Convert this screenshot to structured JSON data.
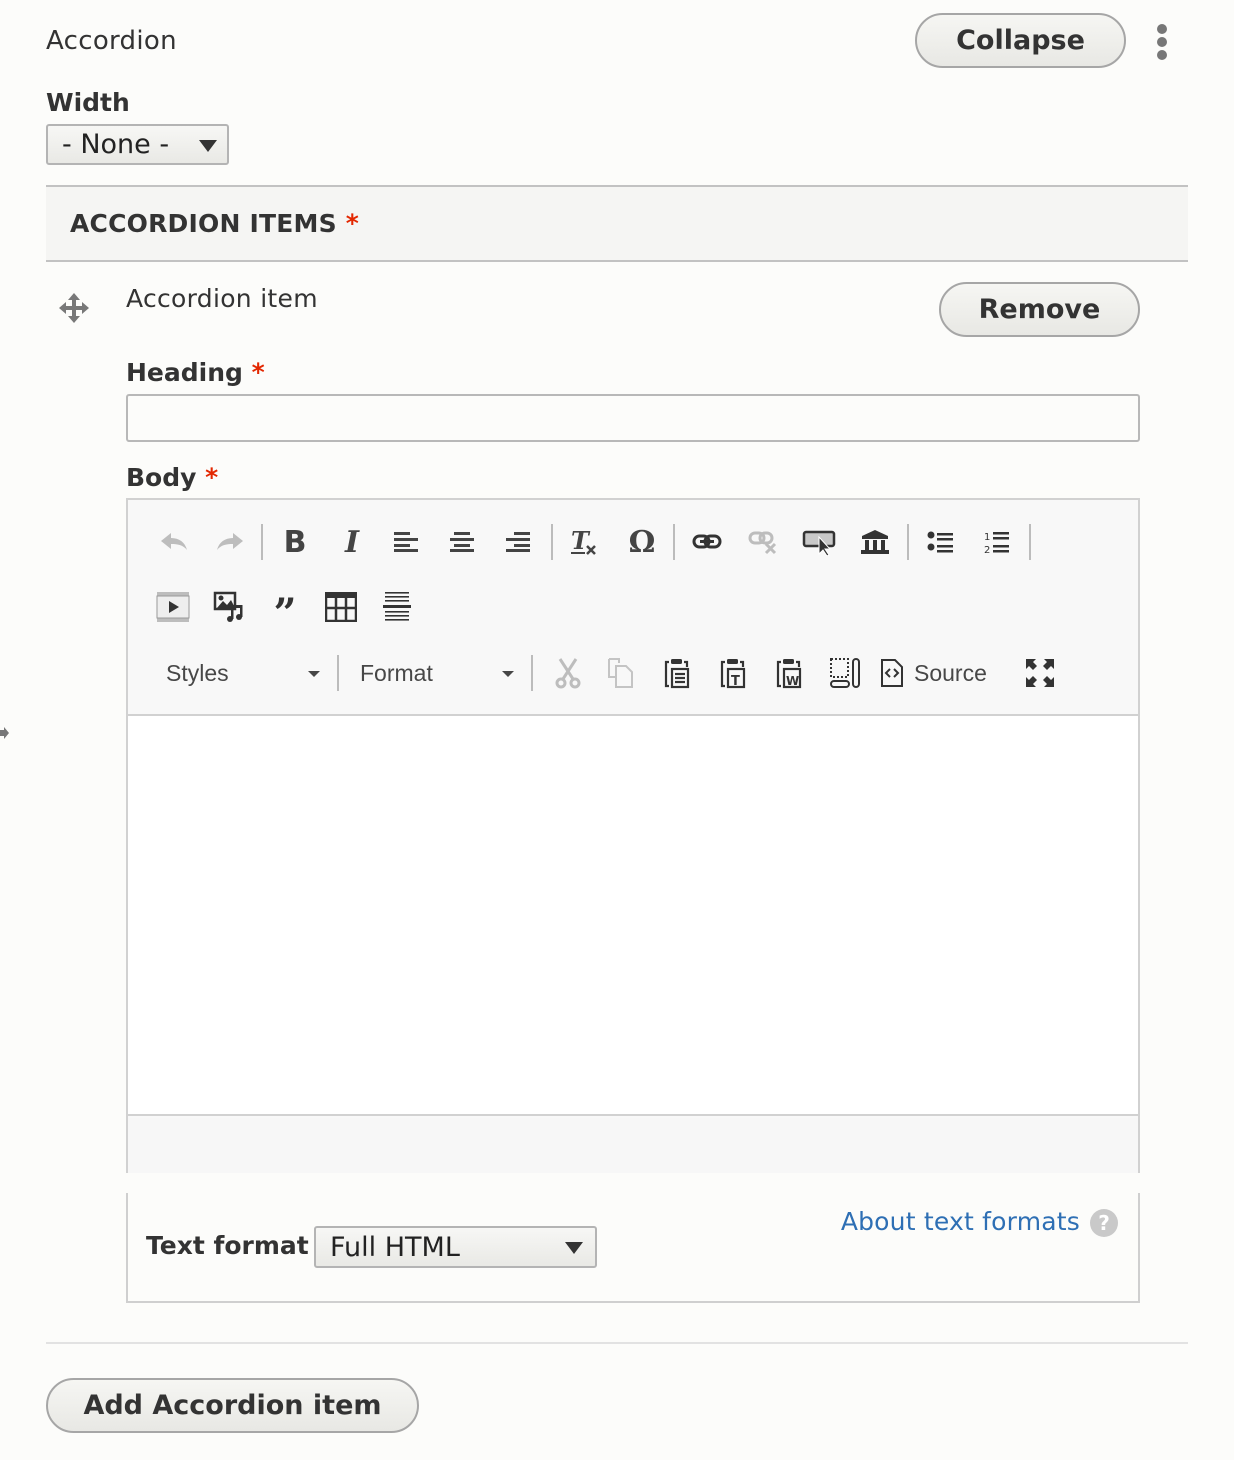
{
  "paragraph": {
    "title": "Accordion",
    "collapse_label": "Collapse",
    "menu_icon": "kebab-icon"
  },
  "width_field": {
    "label": "Width",
    "selected": "- None -"
  },
  "items_section": {
    "label": "ACCORDION ITEMS",
    "required_marker": "*"
  },
  "accordion_item": {
    "title": "Accordion item",
    "remove_label": "Remove",
    "drag_icon": "move-handle-icon",
    "heading": {
      "label": "Heading",
      "required_marker": "*",
      "value": "",
      "placeholder": ""
    },
    "body": {
      "label": "Body",
      "required_marker": "*",
      "value": ""
    }
  },
  "editor_toolbar": {
    "row1": [
      "undo-icon",
      "redo-icon",
      "bold-icon",
      "italic-icon",
      "align-left-icon",
      "align-center-icon",
      "align-right-icon",
      "remove-format-icon",
      "special-character-icon",
      "link-icon",
      "unlink-icon",
      "button-link-icon",
      "museum-icon",
      "bulleted-list-icon",
      "numbered-list-icon"
    ],
    "row2": [
      "video-icon",
      "media-icon",
      "blockquote-icon",
      "table-icon",
      "horizontal-line-icon"
    ],
    "styles_label": "Styles",
    "format_label": "Format",
    "row3": [
      "cut-icon",
      "copy-icon",
      "paste-icon",
      "paste-text-icon",
      "paste-word-icon",
      "show-blocks-icon",
      "source-icon",
      "maximize-icon"
    ],
    "source_label": "Source"
  },
  "text_format": {
    "label": "Text format",
    "selected": "Full HTML",
    "about_link": "About text formats",
    "help_glyph": "?"
  },
  "add_item_label": "Add Accordion item",
  "colors": {
    "required": "#e32700",
    "link": "#2e6fb4",
    "background": "#fcfcfa"
  }
}
